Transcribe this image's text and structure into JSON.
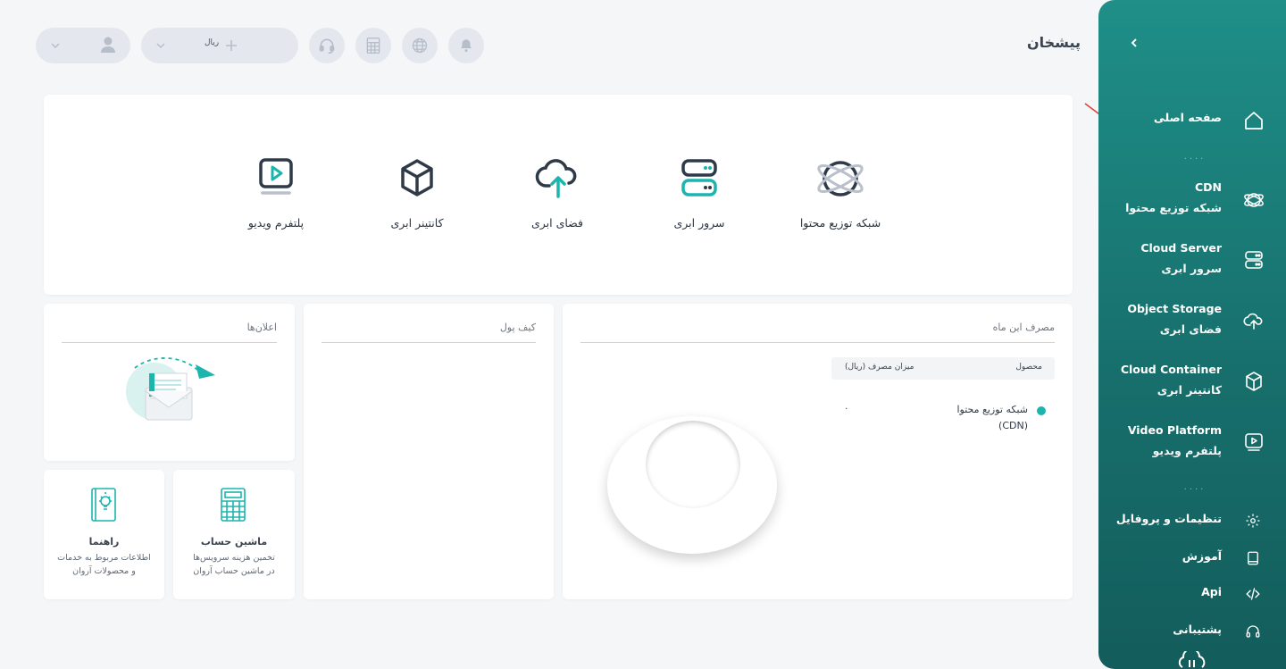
{
  "header": {
    "title": "پیشخان",
    "currency_label": "ریال"
  },
  "services": [
    {
      "label": "شبکه توزیع محتوا",
      "icon": "cdn-icon"
    },
    {
      "label": "سرور ابری",
      "icon": "server-icon"
    },
    {
      "label": "فضای ابری",
      "icon": "cloud-upload-icon"
    },
    {
      "label": "کانتینر ابری",
      "icon": "cube-icon"
    },
    {
      "label": "پلتفرم ویدیو",
      "icon": "video-icon"
    }
  ],
  "usage": {
    "title": "مصرف این ماه",
    "col_product": "محصول",
    "col_amount": "میزان مصرف (ریال)",
    "rows": [
      {
        "product": "شبکه توزیع محتوا",
        "product_sub": "(CDN)",
        "amount": "۰"
      }
    ],
    "colors": {
      "cdn": "#1bb5ad"
    }
  },
  "wallet": {
    "title": "کیف پول"
  },
  "notifications": {
    "title": "اعلان‌ها"
  },
  "calculator": {
    "title": "ماشین حساب",
    "desc1": "تخمین هزینه سرویس‌ها",
    "desc2": "در ماشین حساب آروان"
  },
  "guide": {
    "title": "راهنما",
    "desc1": "اطلاعات مربوط به خدمات",
    "desc2": "و محصولات آروان"
  },
  "sidebar": {
    "dots": "....",
    "home": "صفحه اصلی",
    "items": [
      {
        "en": "CDN",
        "fa": "شبکه توزیع محتوا"
      },
      {
        "en": "Cloud Server",
        "fa": "سرور ابری"
      },
      {
        "en": "Object Storage",
        "fa": "فضای ابری"
      },
      {
        "en": "Cloud Container",
        "fa": "کانتینر ابری"
      },
      {
        "en": "Video Platform",
        "fa": "پلتفرم ویدیو"
      }
    ],
    "settings": "تنظیمات و پروفایل",
    "learning": "آموزش",
    "api": "Api",
    "support": "پشتیبانی"
  },
  "colors": {
    "accent": "#1f8f88",
    "arrow": "#e53935"
  }
}
